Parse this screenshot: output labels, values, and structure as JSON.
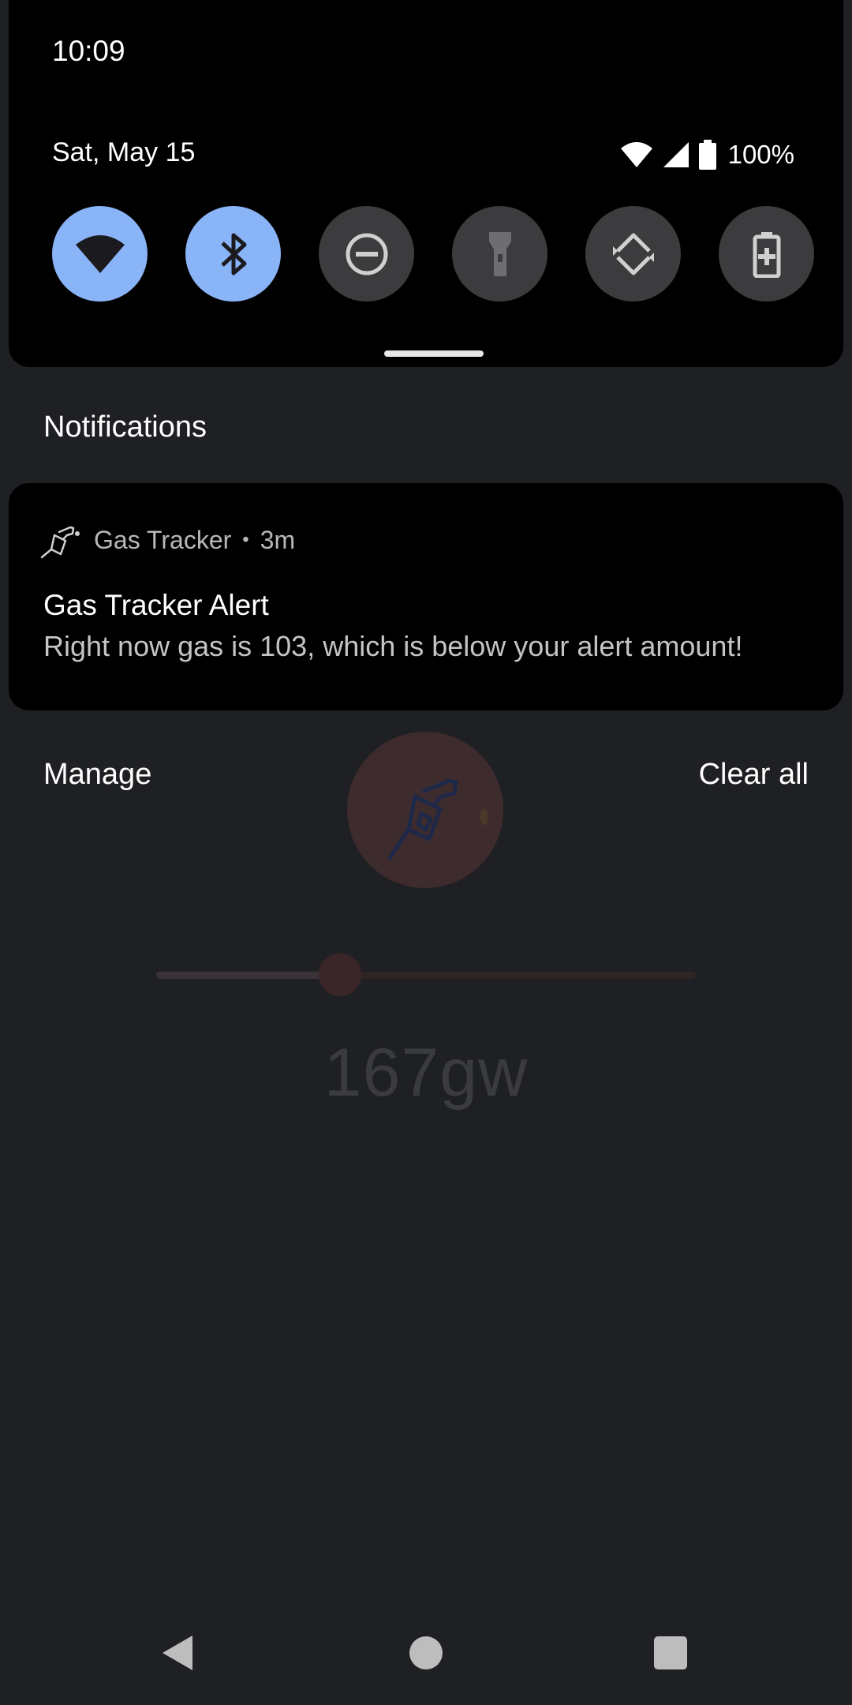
{
  "status_bar": {
    "time": "10:09"
  },
  "quick_settings": {
    "date": "Sat, May 15",
    "battery_percent": "100%",
    "tiles": [
      {
        "name": "wifi",
        "icon": "wifi-icon",
        "active": true
      },
      {
        "name": "bluetooth",
        "icon": "bluetooth-icon",
        "active": true
      },
      {
        "name": "do-not-disturb",
        "icon": "do-not-disturb-icon",
        "active": false
      },
      {
        "name": "flashlight",
        "icon": "flashlight-icon",
        "active": false
      },
      {
        "name": "auto-rotate",
        "icon": "auto-rotate-icon",
        "active": false
      },
      {
        "name": "battery-saver",
        "icon": "battery-saver-icon",
        "active": false
      }
    ],
    "colors": {
      "active_tile": "#8ab4f8",
      "inactive_tile": "#3c3c3e"
    }
  },
  "notifications": {
    "header": "Notifications",
    "items": [
      {
        "app_icon": "gas-pump-icon",
        "app_name": "Gas Tracker",
        "separator": "•",
        "time": "3m",
        "title": "Gas Tracker Alert",
        "text": "Right now gas is 103, which is below your alert amount!"
      }
    ],
    "manage_label": "Manage",
    "clear_all_label": "Clear all"
  },
  "background_app": {
    "fab_icon": "gas-pump-icon",
    "slider_fraction": 0.34,
    "value": "167gw"
  },
  "nav_bar": {
    "back_icon": "back-triangle-icon",
    "home_icon": "home-circle-icon",
    "recents_icon": "recents-square-icon"
  }
}
